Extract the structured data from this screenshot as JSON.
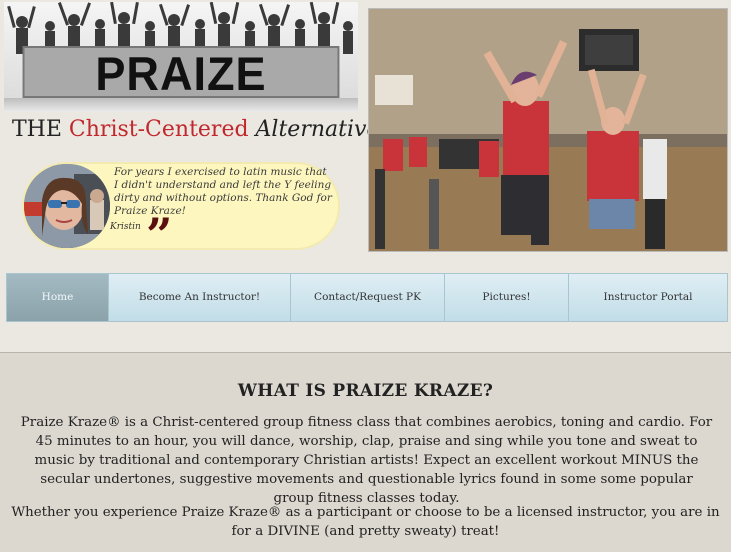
{
  "logo": {
    "text": "PRAIZE KRAZE",
    "icon": "crowd-silhouette-icon"
  },
  "tagline": {
    "prefix": "THE ",
    "highlight": "Christ-Centered",
    "italic": "Alternative",
    "suffix": "!"
  },
  "testimonial": {
    "text": "For years I exercised to latin music that I didn't understand and left the Y feeling dirty and without options. Thank God for Praize Kraze!",
    "author": "Kristin",
    "quote_mark": "”"
  },
  "nav": {
    "items": [
      {
        "label": "Home"
      },
      {
        "label": "Become An Instructor!"
      },
      {
        "label": "Contact/Request PK"
      },
      {
        "label": "Pictures!"
      },
      {
        "label": "Instructor Portal"
      }
    ]
  },
  "content": {
    "heading": "WHAT IS PRAIZE KRAZE?",
    "paragraph1": "Praize Kraze® is a Christ-centered group fitness class that combines aerobics, toning and cardio.  For 45 minutes to an hour, you will dance, worship, clap, praise and sing while you tone and sweat to music by traditional and contemporary Christian artists!  Expect an excellent workout MINUS the secular undertones, suggestive movements and questionable lyrics found in some some popular group fitness classes today.",
    "paragraph2": "Whether you experience Praize Kraze® as a participant or choose to be a licensed instructor, you are in for a DIVINE (and pretty sweaty) treat!"
  },
  "colors": {
    "accent_red": "#c0282d",
    "nav_bg": "#c2dde8",
    "nav_active": "#8ba2ab",
    "quote_bg": "#fdf7bf"
  }
}
